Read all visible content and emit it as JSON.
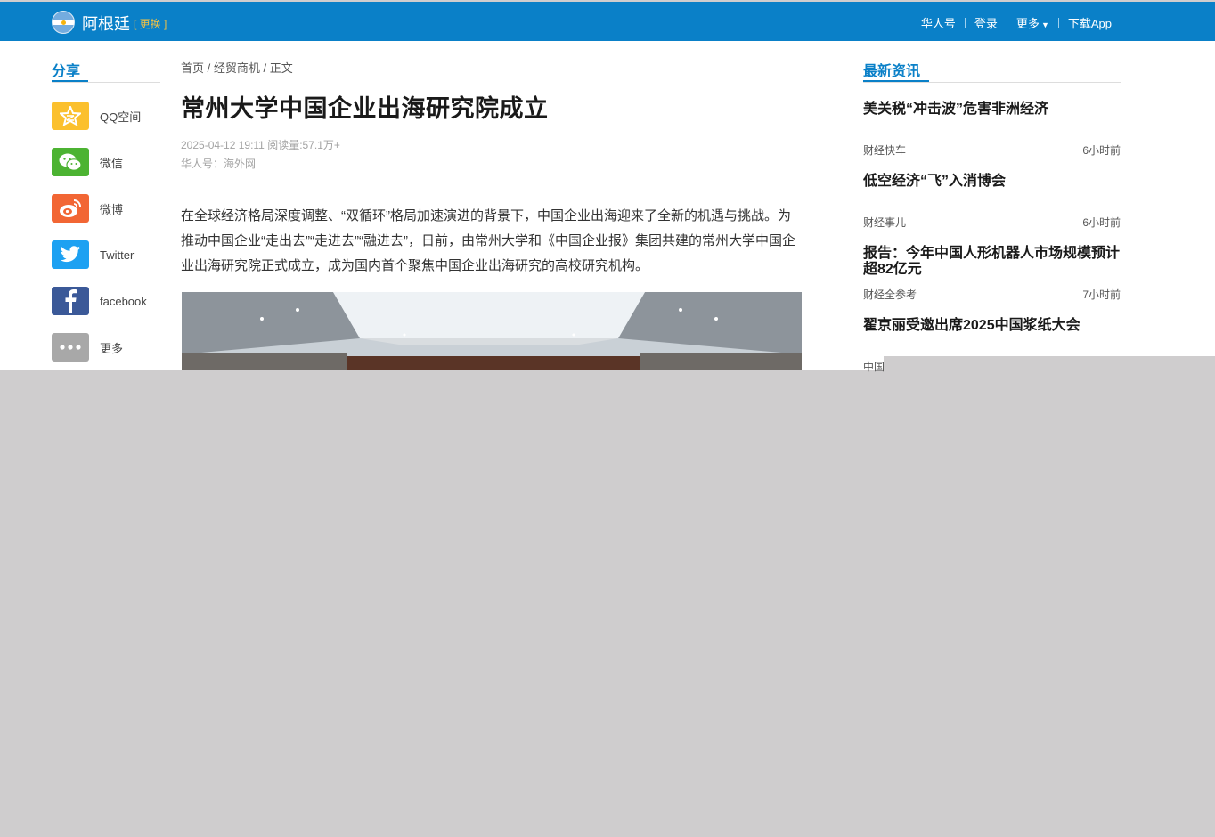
{
  "header": {
    "country": "阿根廷",
    "switch_label": "[ 更换 ]",
    "nav": [
      "华人号",
      "登录",
      "更多",
      "下载App"
    ],
    "brand_color": "#0a80c8"
  },
  "share": {
    "title": "分享",
    "items": [
      {
        "label": "QQ空间",
        "icon": "qzone-icon",
        "color": "#fbc02d"
      },
      {
        "label": "微信",
        "icon": "wechat-icon",
        "color": "#4cb332"
      },
      {
        "label": "微博",
        "icon": "weibo-icon",
        "color": "#f26634"
      },
      {
        "label": "Twitter",
        "icon": "twitter-icon",
        "color": "#1da1f2"
      },
      {
        "label": "facebook",
        "icon": "facebook-icon",
        "color": "#3b5998"
      },
      {
        "label": "更多",
        "icon": "more-icon",
        "color": "#a8a8a8"
      }
    ]
  },
  "article": {
    "breadcrumb": [
      "首页 /",
      "经贸商机 /",
      "正文"
    ],
    "title": "常州大学中国企业出海研究院成立",
    "meta_line": "2025-04-12 19:11 阅读量:57.1万+",
    "source_line": "华人号：海外网",
    "paragraph": "在全球经济格局深度调整、“双循环”格局加速演进的背景下，中国企业出海迎来了全新的机遇与挑战。为推动中国企业“走出去”“走进去”“融进去”，日前，由常州大学和《中国企业报》集团共建的常州大学中国企业出海研究院正式成立，成为国内首个聚焦中国企业出海研究的高校研究机构。"
  },
  "news": {
    "title": "最新资讯",
    "items": [
      {
        "headline": "美关税“冲击波”危害非洲经济",
        "source": "财经快车",
        "time": "6小时前"
      },
      {
        "headline": "低空经济“飞”入消博会",
        "source": "财经事儿",
        "time": "6小时前"
      },
      {
        "headline": "报告：今年中国人形机器人市场规模预计超82亿元",
        "source": "财经全参考",
        "time": "7小时前"
      },
      {
        "headline": "翟京丽受邀出席2025中国浆纸大会",
        "source": "中国",
        "time": ""
      }
    ]
  }
}
